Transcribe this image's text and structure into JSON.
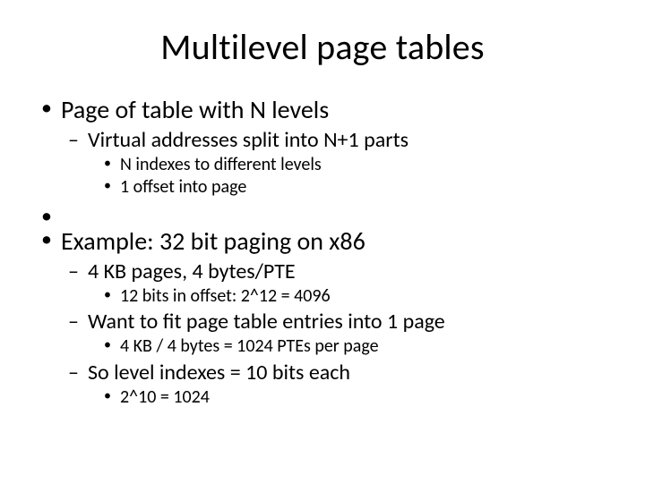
{
  "title": "Multilevel page tables",
  "blocks": [
    {
      "text": "Page of table with N levels",
      "sub": [
        {
          "text": "Virtual addresses split into N+1 parts",
          "sub": [
            {
              "text": "N indexes to different levels"
            },
            {
              "text": "1 offset into page"
            }
          ]
        }
      ]
    },
    {
      "text": "Example: 32 bit paging on x86",
      "sub": [
        {
          "text": "4 KB pages, 4 bytes/PTE",
          "sub": [
            {
              "text": "12 bits in offset: 2^12 = 4096"
            }
          ]
        },
        {
          "text": "Want to fit page table entries into 1 page",
          "sub": [
            {
              "text": "4 KB / 4 bytes = 1024 PTEs per page"
            }
          ]
        },
        {
          "text": "So level indexes = 10 bits each",
          "sub": [
            {
              "text": "2^10 = 1024"
            }
          ]
        }
      ]
    }
  ]
}
